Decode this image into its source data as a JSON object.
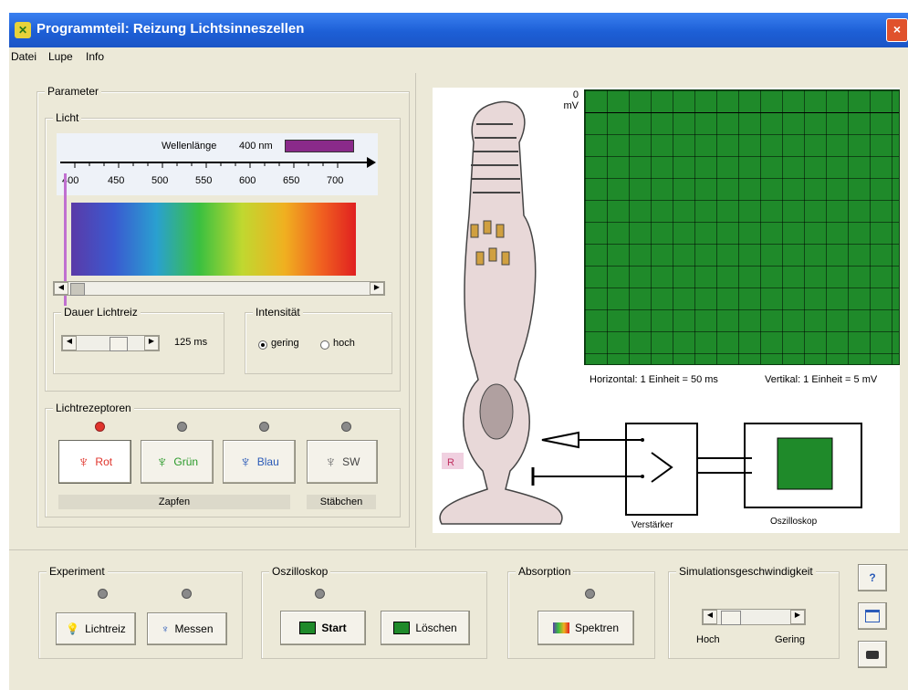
{
  "window": {
    "title": "Programmteil: Reizung Lichtsinneszellen",
    "close_symbol": "×"
  },
  "menu": [
    "Datei",
    "Lupe",
    "Info"
  ],
  "parameter": {
    "group_label": "Parameter",
    "licht": {
      "group_label": "Licht",
      "wavelength_label": "Wellenlänge",
      "wavelength_value": "400 nm",
      "wavelength_color": "#8a2a8a",
      "ticks": [
        "400",
        "450",
        "500",
        "550",
        "600",
        "650",
        "700"
      ]
    },
    "dauer": {
      "group_label": "Dauer Lichtreiz",
      "value": "125 ms"
    },
    "intensitaet": {
      "group_label": "Intensität",
      "options": [
        "gering",
        "hoch"
      ],
      "selected": "gering"
    },
    "rezeptoren": {
      "group_label": "Lichtrezeptoren",
      "buttons": [
        {
          "label": "Rot",
          "color": "#e0342c",
          "active": true
        },
        {
          "label": "Grün",
          "color": "#2a9a2a",
          "active": false
        },
        {
          "label": "Blau",
          "color": "#2a5ab8",
          "active": false
        },
        {
          "label": "SW",
          "color": "#444444",
          "active": false
        }
      ],
      "zapfen_label": "Zapfen",
      "staebchen_label": "Stäbchen"
    }
  },
  "oscilloscope": {
    "zero_label": "0",
    "unit_label": "mV",
    "horizontal": "Horizontal: 1 Einheit = 50 ms",
    "vertical": "Vertikal: 1 Einheit = 5 mV",
    "screen_color": "#1f8a2a"
  },
  "diagram": {
    "cell_label": "R",
    "verstaerker_label": "Verstärker",
    "oszilloskop_label": "Oszilloskop"
  },
  "experiment": {
    "group_label": "Experiment",
    "lichtreiz_label": "Lichtreiz",
    "messen_label": "Messen"
  },
  "oszilloskop_panel": {
    "group_label": "Oszilloskop",
    "start_label": "Start",
    "loeschen_label": "Löschen"
  },
  "absorption": {
    "group_label": "Absorption",
    "spektren_label": "Spektren"
  },
  "simulation": {
    "group_label": "Simulationsgeschwindigkeit",
    "hoch_label": "Hoch",
    "gering_label": "Gering"
  },
  "side_buttons": [
    "help-icon",
    "window-icon",
    "camera-icon"
  ]
}
